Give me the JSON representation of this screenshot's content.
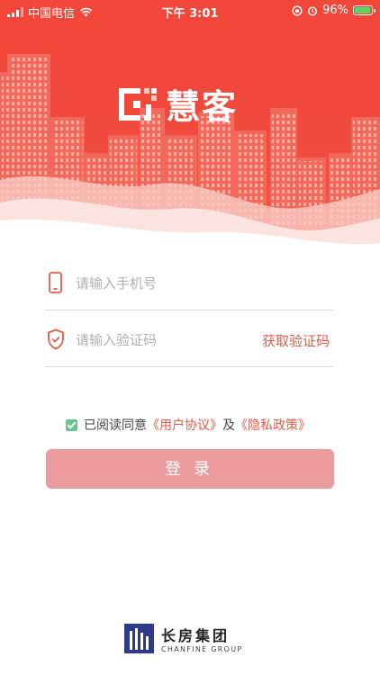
{
  "status_bar": {
    "carrier": "中国电信",
    "time": "下午 3:01",
    "battery": "96%",
    "battery_level_pct": 96
  },
  "brand": {
    "name": "慧客",
    "logo_icon": "brand-logo-icon"
  },
  "form": {
    "phone_placeholder": "请输入手机号",
    "phone_value": "",
    "code_placeholder": "请输入验证码",
    "code_value": "",
    "get_code_label": "获取验证码",
    "phone_icon": "phone-icon",
    "shield_icon": "shield-check-icon"
  },
  "agreement": {
    "checked": true,
    "prefix": "已阅读同意",
    "user_agreement": "《用户协议》",
    "and": "及",
    "privacy_policy": "《隐私政策》"
  },
  "login_button": "登录",
  "footer": {
    "company_cn": "长房集团",
    "company_en": "CHANFINE GROUP"
  },
  "colors": {
    "primary_red": "#ef4a3d",
    "link_red": "#e35b4a",
    "button_disabled": "#eb9b9d",
    "check_green": "#66c58b",
    "footer_blue": "#2d3a8c"
  }
}
